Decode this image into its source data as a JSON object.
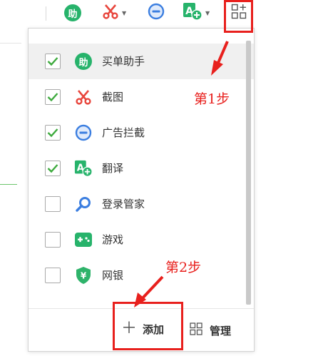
{
  "colors": {
    "accent_red": "#e8201d",
    "check_green": "#3daa3d",
    "helper_green": "#27b36b",
    "shield_green": "#2eb36a",
    "blue": "#3b7ee0"
  },
  "toolbar": {
    "buttons": [
      {
        "icon": "helper-icon",
        "glyph": "助"
      },
      {
        "icon": "scissors-icon"
      },
      {
        "icon": "minus-circle-icon"
      },
      {
        "icon": "translate-icon"
      },
      {
        "icon": "add-grid-icon"
      }
    ]
  },
  "menu": {
    "items": [
      {
        "label": "买单助手",
        "checked": true,
        "icon": "helper-icon",
        "glyph": "助"
      },
      {
        "label": "截图",
        "checked": true,
        "icon": "scissors-icon"
      },
      {
        "label": "广告拦截",
        "checked": true,
        "icon": "minus-circle-icon"
      },
      {
        "label": "翻译",
        "checked": true,
        "icon": "translate-icon"
      },
      {
        "label": "登录管家",
        "checked": false,
        "icon": "key-search-icon"
      },
      {
        "label": "游戏",
        "checked": false,
        "icon": "gamepad-icon"
      },
      {
        "label": "网银",
        "checked": false,
        "icon": "shield-yen-icon",
        "glyph": "¥"
      }
    ],
    "add_label": "添加",
    "manage_label": "管理"
  },
  "annotations": {
    "step1": "第1步",
    "step2": "第2步"
  }
}
